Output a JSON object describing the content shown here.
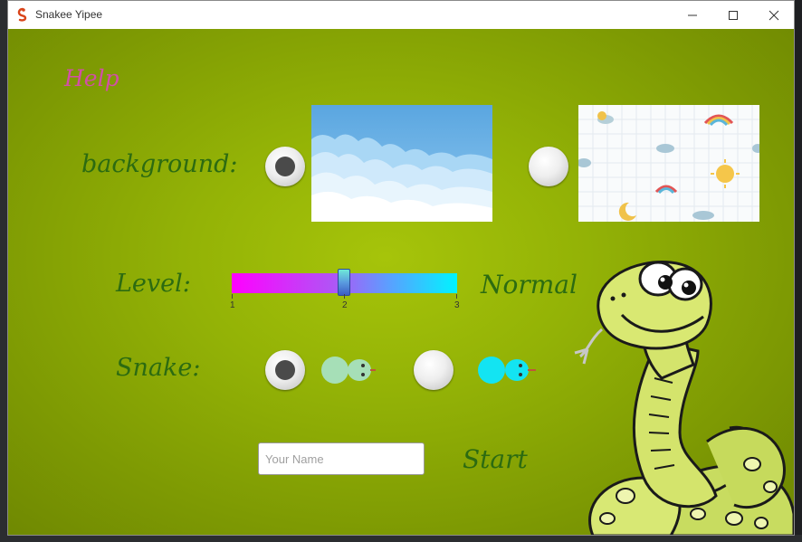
{
  "window": {
    "title": "Snakee Yipee",
    "controls": [
      "minimize",
      "maximize",
      "close"
    ]
  },
  "menu": {
    "help_label": "Help"
  },
  "background": {
    "label": "background:",
    "options": [
      {
        "name": "sky-clouds",
        "selected": true
      },
      {
        "name": "weather-doodles",
        "selected": false
      }
    ]
  },
  "level": {
    "label": "Level:",
    "value": 2,
    "min": 1,
    "max": 3,
    "ticks": [
      "1",
      "2",
      "3"
    ],
    "value_text": "Normal"
  },
  "snake": {
    "label": "Snake:",
    "options": [
      {
        "name": "mint-snake",
        "color": "#a6dfb7",
        "selected": true
      },
      {
        "name": "cyan-snake",
        "color": "#13e4f2",
        "selected": false
      }
    ]
  },
  "player": {
    "name_placeholder": "Your Name",
    "name_value": ""
  },
  "start_label": "Start",
  "colors": {
    "background": "#93b206",
    "label": "#2c6b11",
    "help": "#d24fa6"
  }
}
